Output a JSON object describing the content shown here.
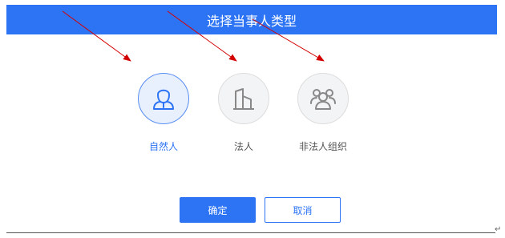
{
  "dialog": {
    "title": "选择当事人类型"
  },
  "options": [
    {
      "label": "自然人",
      "icon": "person-icon",
      "selected": true
    },
    {
      "label": "法人",
      "icon": "building-icon",
      "selected": false
    },
    {
      "label": "非法人组织",
      "icon": "group-icon",
      "selected": false
    }
  ],
  "buttons": {
    "confirm": "确定",
    "cancel": "取消"
  },
  "colors": {
    "primary": "#2d74f5",
    "arrow": "#d40000",
    "selected_bg": "#e8f0fe",
    "unselected_bg": "#f3f4f6"
  },
  "document": {
    "paragraph_mark": "↵"
  }
}
